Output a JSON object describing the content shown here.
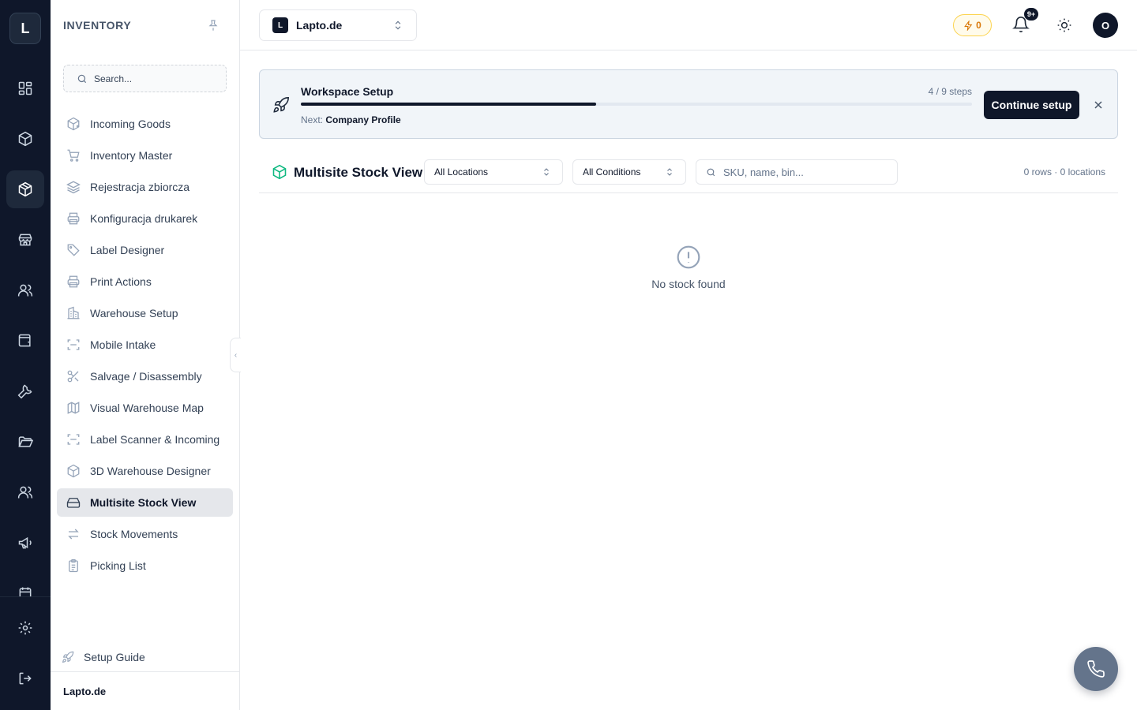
{
  "rail": {
    "logo": "L",
    "icons": [
      "dashboard-icon",
      "package-icon",
      "inventory-icon",
      "store-icon",
      "users-icon",
      "wallet-icon",
      "wrench-icon",
      "folder-icon",
      "team-icon",
      "megaphone-icon",
      "calendar-icon"
    ],
    "bottom_icons": [
      "settings-icon",
      "logout-icon"
    ]
  },
  "sidebar": {
    "title": "INVENTORY",
    "search_placeholder": "Search...",
    "items": [
      {
        "label": "Incoming Goods",
        "icon": "package-plus-icon"
      },
      {
        "label": "Inventory Master",
        "icon": "cart-icon"
      },
      {
        "label": "Rejestracja zbiorcza",
        "icon": "layers-icon"
      },
      {
        "label": "Konfiguracja drukarek",
        "icon": "printer-icon"
      },
      {
        "label": "Label Designer",
        "icon": "tag-icon"
      },
      {
        "label": "Print Actions",
        "icon": "printer-icon"
      },
      {
        "label": "Warehouse Setup",
        "icon": "building-icon"
      },
      {
        "label": "Mobile Intake",
        "icon": "scan-icon"
      },
      {
        "label": "Salvage / Disassembly",
        "icon": "scissors-icon"
      },
      {
        "label": "Visual Warehouse Map",
        "icon": "map-icon"
      },
      {
        "label": "Label Scanner & Incoming",
        "icon": "scan-icon"
      },
      {
        "label": "3D Warehouse Designer",
        "icon": "cube-icon"
      },
      {
        "label": "Multisite Stock View",
        "icon": "hard-drive-icon",
        "active": true
      },
      {
        "label": "Stock Movements",
        "icon": "arrows-icon"
      },
      {
        "label": "Picking List",
        "icon": "clipboard-icon"
      }
    ],
    "setup_guide": "Setup Guide",
    "footer": "Lapto.de"
  },
  "header": {
    "workspace_badge": "L",
    "workspace_name": "Lapto.de",
    "credits": "0",
    "notifications_badge": "9+",
    "avatar": "O"
  },
  "banner": {
    "title": "Workspace Setup",
    "steps": "4 / 9 steps",
    "progress_percent": 44,
    "next_label": "Next:",
    "next_value": "Company Profile",
    "button": "Continue setup"
  },
  "stock": {
    "title": "Multisite Stock View",
    "location_filter": "All Locations",
    "condition_filter": "All Conditions",
    "search_placeholder": "SKU, name, bin...",
    "counts": "0 rows · 0 locations",
    "empty_text": "No stock found"
  },
  "colors": {
    "rail_bg": "#0f172a",
    "accent": "#0f172a",
    "stock_icon": "#10b981",
    "credits": "#d97706",
    "fab": "#64748b"
  }
}
